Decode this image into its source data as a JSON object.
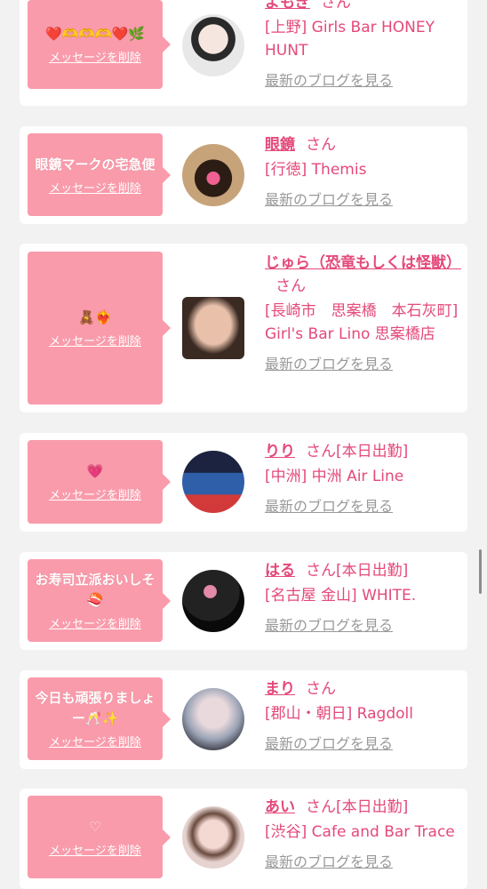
{
  "colors": {
    "accent": "#e4497a",
    "bubble": "#f99bab",
    "link_gray": "#999999"
  },
  "delete_label": "メッセージを削除",
  "blog_label": "最新のブログを見る",
  "san_label": "さん",
  "cards": [
    {
      "message": "❤️🫶🫶🫶❤️🌿",
      "name": "よもぎ",
      "status": "",
      "shop": "[上野] Girls Bar HONEY HUNT"
    },
    {
      "message": "眼鏡マークの宅急便",
      "name": "眼鏡",
      "status": "",
      "shop": "[行徳] Themis"
    },
    {
      "message": "🧸❤️‍🔥",
      "name": "じゅら（恐竜もしくは怪獣）",
      "status": "",
      "shop": "[長崎市　思案橋　本石灰町] Girl's Bar Lino 思案橋店"
    },
    {
      "message": "💗",
      "name": "りり",
      "status": "[本日出勤]",
      "shop": "[中洲] 中洲 Air Line"
    },
    {
      "message": "お寿司立派おいしそ🍣",
      "name": "はる",
      "status": "[本日出勤]",
      "shop": "[名古屋 金山] WHITE."
    },
    {
      "message": "今日も頑張りましょー🥂✨",
      "name": "まり",
      "status": "",
      "shop": "[郡山・朝日] Ragdoll"
    },
    {
      "message": "♡",
      "name": "あい",
      "status": "[本日出勤]",
      "shop": "[渋谷] Cafe and Bar Trace"
    }
  ]
}
